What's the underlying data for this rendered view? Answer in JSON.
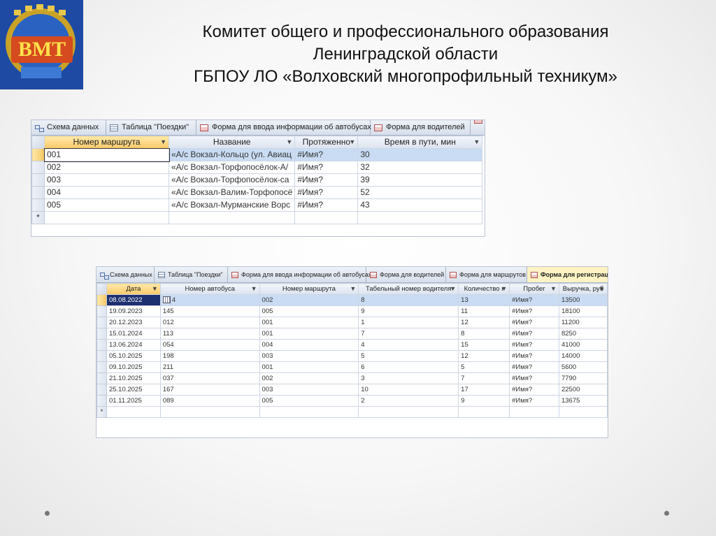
{
  "header": {
    "line1": "Комитет общего и профессионального образования",
    "line2": "Ленинградской области",
    "line3": "ГБПОУ ЛО  «Волховский многопрофильный техникум»",
    "logo_text": "ВМТ"
  },
  "window1": {
    "tabs": [
      {
        "label": "Схема данных",
        "icon": "schema-icon"
      },
      {
        "label": "Таблица \"Поездки\"",
        "icon": "table-icon"
      },
      {
        "label": "Форма для ввода информации об автобусах",
        "icon": "form-icon"
      },
      {
        "label": "Форма для водителей",
        "icon": "form-icon"
      }
    ],
    "columns": [
      "Номер маршрута",
      "Название",
      "Протяженно",
      "Время в пути, мин"
    ],
    "rows": [
      [
        "001",
        "«А/с Вокзал-Кольцо (ул. Авиац",
        "#Имя?",
        "30"
      ],
      [
        "002",
        "«А/с Вокзал-Торфопосёлок-А/",
        "#Имя?",
        "32"
      ],
      [
        "003",
        "«А/с Вокзал-Торфопосёлок-са",
        "#Имя?",
        "39"
      ],
      [
        "004",
        "«А/с Вокзал-Валим-Торфопосё",
        "#Имя?",
        "52"
      ],
      [
        "005",
        "«А/с Вокзал-Мурманские Ворс",
        "#Имя?",
        "43"
      ]
    ],
    "new_row_marker": "*"
  },
  "window2": {
    "tabs": [
      {
        "label": "Схема данных",
        "icon": "schema-icon"
      },
      {
        "label": "Таблица \"Поездки\"",
        "icon": "table-icon"
      },
      {
        "label": "Форма для ввода информации об автобусах",
        "icon": "form-icon"
      },
      {
        "label": "Форма для водителей",
        "icon": "form-icon"
      },
      {
        "label": "Форма для маршрутов",
        "icon": "form-icon"
      },
      {
        "label": "Форма для регистрации",
        "icon": "form-icon"
      }
    ],
    "columns": [
      "Дата",
      "Номер автобуса",
      "Номер маршрута",
      "Табельный номер водителя",
      "Количество г",
      "Пробег",
      "Выручка, руб"
    ],
    "rows": [
      [
        "08.08.2022",
        "4",
        "002",
        "8",
        "13",
        "#Имя?",
        "13500"
      ],
      [
        "19.09.2023",
        "145",
        "005",
        "9",
        "11",
        "#Имя?",
        "18100"
      ],
      [
        "20.12.2023",
        "012",
        "001",
        "1",
        "12",
        "#Имя?",
        "11200"
      ],
      [
        "15.01.2024",
        "113",
        "001",
        "7",
        "8",
        "#Имя?",
        "8250"
      ],
      [
        "13.06.2024",
        "054",
        "004",
        "4",
        "15",
        "#Имя?",
        "41000"
      ],
      [
        "05.10.2025",
        "198",
        "003",
        "5",
        "12",
        "#Имя?",
        "14000"
      ],
      [
        "09.10.2025",
        "211",
        "001",
        "6",
        "5",
        "#Имя?",
        "5600"
      ],
      [
        "21.10.2025",
        "037",
        "002",
        "3",
        "7",
        "#Имя?",
        "7790"
      ],
      [
        "25.10.2025",
        "167",
        "003",
        "10",
        "17",
        "#Имя?",
        "22500"
      ],
      [
        "01.11.2025",
        "089",
        "005",
        "2",
        "9",
        "#Имя?",
        "13675"
      ]
    ],
    "new_row_marker": "*"
  }
}
